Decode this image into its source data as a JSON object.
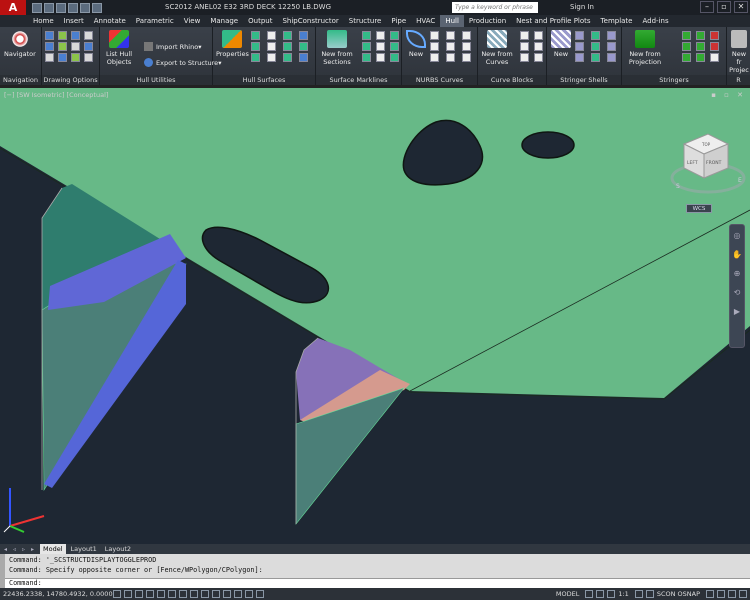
{
  "app": {
    "logo": "A",
    "title": "SC2012    ANEL02 E32 3RD DECK 12250 LB.DWG",
    "search_placeholder": "Type a keyword or phrase",
    "sign_in": "Sign In"
  },
  "tabs": [
    "Home",
    "Insert",
    "Annotate",
    "Parametric",
    "View",
    "Manage",
    "Output",
    "ShipConstructor",
    "Structure",
    "Pipe",
    "HVAC",
    "Hull",
    "Production",
    "Nest and Profile Plots",
    "Template",
    "Add-ins"
  ],
  "active_tab": "Hull",
  "ribbon": {
    "navigation": {
      "title": "Navigation",
      "navigator": "Navigator"
    },
    "drawing_options": {
      "title": "Drawing Options"
    },
    "hull_utilities": {
      "title": "Hull Utilities",
      "list_hull_objects": "List Hull Objects",
      "import_rhino": "Import Rhino",
      "export_structure": "Export to Structure"
    },
    "hull_surfaces": {
      "title": "Hull Surfaces",
      "properties": "Properties"
    },
    "surface_marklines": {
      "title": "Surface Marklines",
      "new_from_sections": "New from Sections"
    },
    "nurbs_curves": {
      "title": "NURBS Curves",
      "new": "New"
    },
    "curve_blocks": {
      "title": "Curve Blocks",
      "new_from_curves": "New from Curves"
    },
    "stringer_shells": {
      "title": "Stringer Shells",
      "new": "New"
    },
    "stringers": {
      "title": "Stringers",
      "new_from_projection": "New from Projection"
    },
    "extra": {
      "title": "R",
      "new_from_projection": "New fr Projec"
    }
  },
  "viewport": {
    "label": "[−] [SW Isometric] [Conceptual]",
    "controls": "▪ ▫ ✕",
    "viewcube": {
      "top": "TOP",
      "left": "LEFT",
      "front": "FRONT",
      "compass_s": "S",
      "compass_e": "E",
      "wcs": "WCS"
    }
  },
  "layout_tabs": [
    "Model",
    "Layout1",
    "Layout2"
  ],
  "active_layout": "Model",
  "command": {
    "line1": "Command: '_SCSTRUCTDISPLAYTOGGLEPROD",
    "line2": "Command: Specify opposite corner or [Fence/WPolygon/CPolygon]:",
    "prompt": "Command:"
  },
  "status": {
    "coords": "22436.2338, 14780.4932, 0.0000",
    "model": "MODEL",
    "scale": "1:1",
    "scon_osnap": "SCON OSNAP"
  },
  "colors": {
    "deck": "#67b987",
    "background": "#1e2733",
    "bracket_face": "#4b7f78",
    "bracket_edge": "#5566d8",
    "bracket_purple": "#8671b8",
    "bracket_pink": "#d59a8e"
  }
}
